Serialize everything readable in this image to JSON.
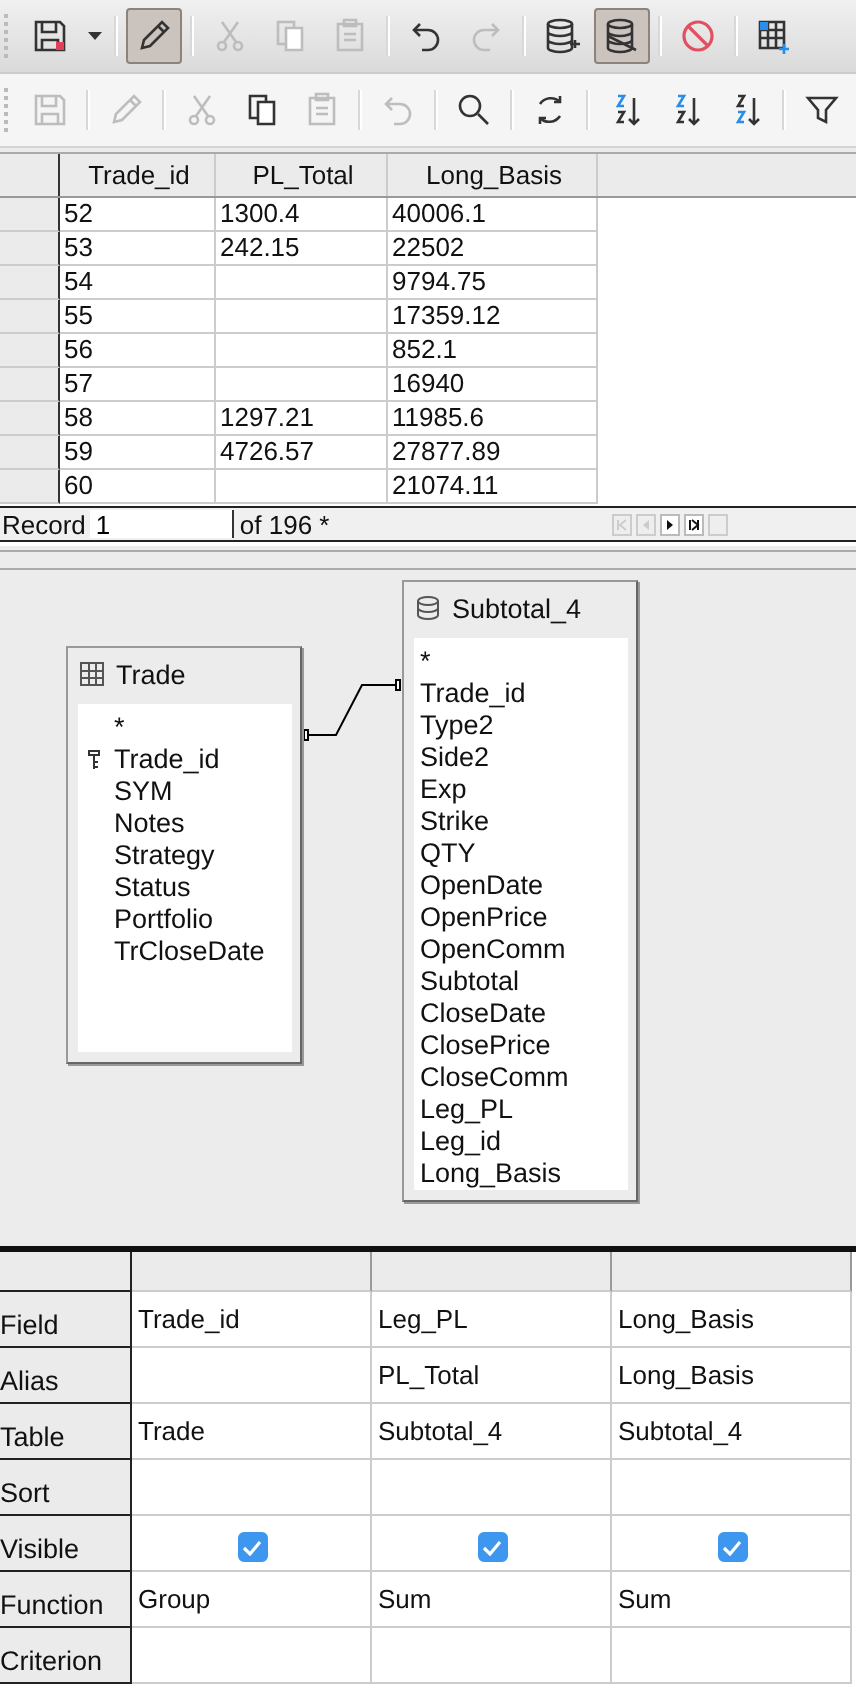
{
  "toolbars": [
    {
      "groups": [
        [
          {
            "kind": "save",
            "disabled": false,
            "pressed": false
          },
          {
            "kind": "dropdown",
            "disabled": false,
            "pressed": false
          }
        ],
        [
          {
            "kind": "edit",
            "disabled": false,
            "pressed": true
          }
        ],
        [
          {
            "kind": "cut",
            "disabled": true,
            "pressed": false
          },
          {
            "kind": "copy",
            "disabled": true,
            "pressed": false
          },
          {
            "kind": "paste",
            "disabled": true,
            "pressed": false
          }
        ],
        [
          {
            "kind": "undo",
            "disabled": false,
            "pressed": false
          },
          {
            "kind": "redo",
            "disabled": true,
            "pressed": false
          }
        ],
        [
          {
            "kind": "db-add",
            "disabled": false,
            "pressed": false
          },
          {
            "kind": "db-edit",
            "disabled": false,
            "pressed": true
          }
        ],
        [
          {
            "kind": "cancel",
            "disabled": false,
            "pressed": false
          }
        ],
        [
          {
            "kind": "table-add",
            "disabled": false,
            "pressed": false
          }
        ]
      ]
    },
    {
      "groups": [
        [
          {
            "kind": "save",
            "disabled": true,
            "pressed": false
          }
        ],
        [
          {
            "kind": "edit",
            "disabled": true,
            "pressed": false
          }
        ],
        [
          {
            "kind": "cut",
            "disabled": true,
            "pressed": false
          },
          {
            "kind": "copy",
            "disabled": false,
            "pressed": false
          },
          {
            "kind": "paste",
            "disabled": true,
            "pressed": false
          }
        ],
        [
          {
            "kind": "undo",
            "disabled": true,
            "pressed": false
          }
        ],
        [
          {
            "kind": "search",
            "disabled": false,
            "pressed": false
          }
        ],
        [
          {
            "kind": "refresh",
            "disabled": false,
            "pressed": false
          }
        ],
        [
          {
            "kind": "sort-asc",
            "disabled": false,
            "pressed": false
          },
          {
            "kind": "sort-asc",
            "disabled": false,
            "pressed": false
          },
          {
            "kind": "sort-desc",
            "disabled": false,
            "pressed": false
          }
        ],
        [
          {
            "kind": "filter",
            "disabled": false,
            "pressed": false
          }
        ]
      ]
    }
  ],
  "results": {
    "columns": [
      "Trade_id",
      "PL_Total",
      "Long_Basis"
    ],
    "rows": [
      [
        "52",
        "1300.4",
        "40006.1"
      ],
      [
        "53",
        "242.15",
        "22502"
      ],
      [
        "54",
        "",
        "9794.75"
      ],
      [
        "55",
        "",
        "17359.12"
      ],
      [
        "56",
        "",
        "852.1"
      ],
      [
        "57",
        "",
        "16940"
      ],
      [
        "58",
        "1297.21",
        "11985.6"
      ],
      [
        "59",
        "4726.57",
        "27877.89"
      ],
      [
        "60",
        "",
        "21074.11"
      ]
    ],
    "record_label": "Record",
    "record_value": "1",
    "record_total": "of 196 *"
  },
  "tables": [
    {
      "name": "Trade",
      "kind": "table",
      "fields": [
        {
          "name": "*",
          "primary_key": false
        },
        {
          "name": "Trade_id",
          "primary_key": true
        },
        {
          "name": "SYM",
          "primary_key": false
        },
        {
          "name": "Notes",
          "primary_key": false
        },
        {
          "name": "Strategy",
          "primary_key": false
        },
        {
          "name": "Status",
          "primary_key": false
        },
        {
          "name": "Portfolio",
          "primary_key": false
        },
        {
          "name": "TrCloseDate",
          "primary_key": false
        }
      ]
    },
    {
      "name": "Subtotal_4",
      "kind": "query",
      "fields": [
        {
          "name": "*",
          "primary_key": false
        },
        {
          "name": "Trade_id",
          "primary_key": false
        },
        {
          "name": "Type2",
          "primary_key": false
        },
        {
          "name": "Side2",
          "primary_key": false
        },
        {
          "name": "Exp",
          "primary_key": false
        },
        {
          "name": "Strike",
          "primary_key": false
        },
        {
          "name": "QTY",
          "primary_key": false
        },
        {
          "name": "OpenDate",
          "primary_key": false
        },
        {
          "name": "OpenPrice",
          "primary_key": false
        },
        {
          "name": "OpenComm",
          "primary_key": false
        },
        {
          "name": "Subtotal",
          "primary_key": false
        },
        {
          "name": "CloseDate",
          "primary_key": false
        },
        {
          "name": "ClosePrice",
          "primary_key": false
        },
        {
          "name": "CloseComm",
          "primary_key": false
        },
        {
          "name": "Leg_PL",
          "primary_key": false
        },
        {
          "name": "Leg_id",
          "primary_key": false
        },
        {
          "name": "Long_Basis",
          "primary_key": false
        }
      ]
    }
  ],
  "design_grid": {
    "row_labels": [
      "Field",
      "Alias",
      "Table",
      "Sort",
      "Visible",
      "Function",
      "Criterion"
    ],
    "columns": [
      {
        "field": "Trade_id",
        "table": "Trade",
        "visible": true,
        "function": "Group"
      },
      {
        "field": "Leg_PL",
        "alias": "PL_Total",
        "table": "Subtotal_4",
        "visible": true,
        "function": "Sum"
      },
      {
        "field": "Long_Basis",
        "alias": "Long_Basis",
        "table": "Subtotal_4",
        "visible": true,
        "function": "Sum"
      }
    ]
  }
}
